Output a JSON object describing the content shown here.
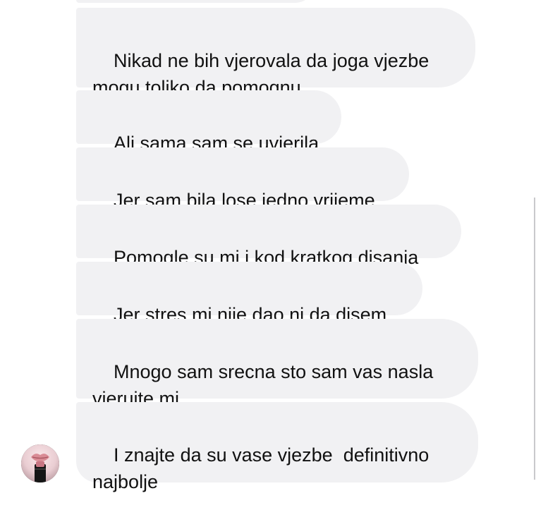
{
  "messages": [
    {
      "text": "Nikad ne bih vjerovala da joga vjezbe\nmogu toliko da pomognu"
    },
    {
      "text": "Ali sama sam se uvjerila"
    },
    {
      "text": "Jer sam bila lose jedno vrijeme"
    },
    {
      "text": "Pomogle su mi i kod kratkog disanja"
    },
    {
      "text": "Jer stres mi nije dao ni da disem"
    },
    {
      "text": "Mnogo sam srecna sto sam vas nasla\nvjerujte mi"
    },
    {
      "text": "I znajte da su vase vjezbe  definitivno\nnajbolje"
    }
  ],
  "avatar": {
    "icon": "lipstick-profile-avatar"
  },
  "colors": {
    "bubble_bg": "#f1f1f3",
    "text": "#111111",
    "background": "#ffffff"
  }
}
